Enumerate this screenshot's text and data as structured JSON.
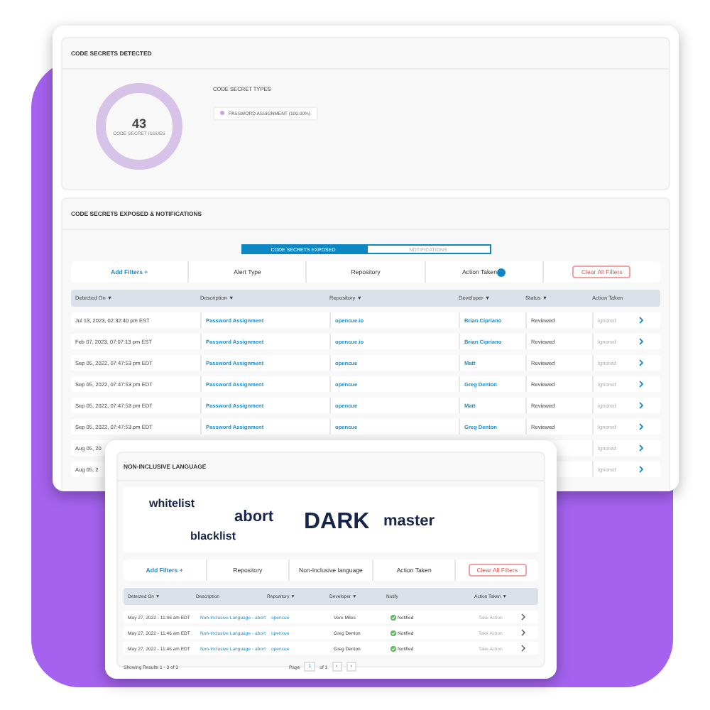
{
  "secrets_detected": {
    "title": "CODE SECRETS DETECTED",
    "total": "43",
    "total_label": "CODE SECRET ISSUES",
    "types_title": "CODE SECRET TYPES",
    "types": [
      {
        "label": "PASSWORD ASSIGNMENT (100.00%)",
        "color": "#c9a6e0"
      }
    ]
  },
  "secrets_exposed": {
    "title": "CODE SECRETS EXPOSED & NOTIFICATIONS",
    "tabs": [
      {
        "label": "CODE SECRETS EXPOSED",
        "selected": true
      },
      {
        "label": "NOTIFICATIONS",
        "selected": false
      }
    ],
    "filters": [
      {
        "label": "Add Filters +",
        "kind": "add"
      },
      {
        "label": "Alert Type",
        "kind": "plain"
      },
      {
        "label": "Repository",
        "kind": "plain"
      },
      {
        "label": "Action Taken",
        "kind": "badge"
      },
      {
        "label": "Clear All Filters",
        "kind": "clear"
      }
    ],
    "columns": [
      "Detected On ▼",
      "Description ▼",
      "Repository ▼",
      "Developer ▼",
      "Status ▼",
      "Action Taken"
    ],
    "rows": [
      {
        "detected_on": "Jul 13, 2023, 02:32:40 pm EST",
        "description": "Password Assignment",
        "repository": "opencue.io",
        "developer": "Brian Cipriano",
        "status": "Reviewed",
        "action_taken": "Ignored"
      },
      {
        "detected_on": "Feb 07, 2023, 07:07:13 pm EST",
        "description": "Password Assignment",
        "repository": "opencue.io",
        "developer": "Brian Cipriano",
        "status": "Reviewed",
        "action_taken": "Ignored"
      },
      {
        "detected_on": "Sep 05, 2022, 07:47:53 pm EDT",
        "description": "Password Assignment",
        "repository": "opencue",
        "developer": "Matt",
        "status": "Reviewed",
        "action_taken": "Ignored"
      },
      {
        "detected_on": "Sep 05, 2022, 07:47:53 pm EDT",
        "description": "Password Assignment",
        "repository": "opencue",
        "developer": "Greg Denton",
        "status": "Reviewed",
        "action_taken": "Ignored"
      },
      {
        "detected_on": "Sep 05, 2022, 07:47:53 pm EDT",
        "description": "Password Assignment",
        "repository": "opencue",
        "developer": "Matt",
        "status": "Reviewed",
        "action_taken": "Ignored"
      },
      {
        "detected_on": "Sep 05, 2022, 07:47:53 pm EDT",
        "description": "Password Assignment",
        "repository": "opencue",
        "developer": "Greg Denton",
        "status": "Reviewed",
        "action_taken": "Ignored"
      },
      {
        "detected_on": "Aug 05, 20",
        "action_taken": "Ignored"
      },
      {
        "detected_on": "Aug 05, 2",
        "action_taken": "Ignored"
      }
    ]
  },
  "non_inclusive_language": {
    "title": "NON-INCLUSIVE LANGUAGE",
    "words": [
      {
        "text": "whitelist",
        "kind": "small"
      },
      {
        "text": "abort",
        "kind": "medium"
      },
      {
        "text": "DARK",
        "kind": "large"
      },
      {
        "text": "master",
        "kind": "medium"
      },
      {
        "text": "blacklist",
        "kind": "small"
      }
    ],
    "filters": [
      {
        "label": "Add Filters +",
        "kind": "add"
      },
      {
        "label": "Repository",
        "kind": "plain"
      },
      {
        "label": "Non-Inclusive language",
        "kind": "plain"
      },
      {
        "label": "Action Taken",
        "kind": "plain"
      },
      {
        "label": "Clear All Filters",
        "kind": "clear"
      }
    ],
    "columns": [
      "Detected On ▼",
      "Description",
      "Repository ▼",
      "Developer ▼",
      "Notify",
      "Action Taken ▼"
    ],
    "rows": [
      {
        "detected_on": "May 27, 2022 - 11:46 am EDT",
        "description": "Non-Inclusive Language - abort",
        "repository": "opencue",
        "developer": "Vere Miles",
        "notify": "Notified",
        "action_taken": "Take Action"
      },
      {
        "detected_on": "May 27, 2022 - 11:46 am EDT",
        "description": "Non-Inclusive Language - abort",
        "repository": "opencue",
        "developer": "Greg Denton",
        "notify": "Notified",
        "action_taken": "Take Action"
      },
      {
        "detected_on": "May 27, 2022 - 11:46 am EDT",
        "description": "Non-Inclusive Language - abort",
        "repository": "opencue",
        "developer": "Greg Denton",
        "notify": "Notified",
        "action_taken": "Take Action"
      }
    ],
    "results": "Showing Results 1 - 3 of 3",
    "pager": {
      "label": "Page",
      "page": "1",
      "of": "of 1",
      "prev": "‹",
      "next": "›"
    }
  }
}
